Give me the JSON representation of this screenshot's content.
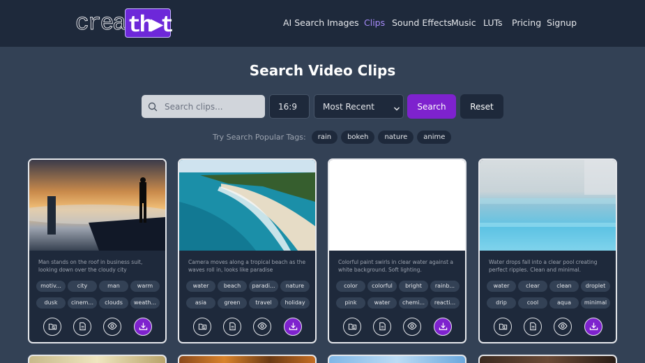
{
  "brand": {
    "logo_a": "create",
    "logo_b": "th▸t"
  },
  "nav": [
    {
      "label": "AI Search",
      "active": false
    },
    {
      "label": "Images",
      "active": false
    },
    {
      "label": "Clips",
      "active": true
    },
    {
      "label": "Sound Effects",
      "active": false
    },
    {
      "label": "Music",
      "active": false
    },
    {
      "label": "LUTs",
      "active": false
    },
    {
      "label": "Pricing",
      "active": false
    },
    {
      "label": "Signup",
      "active": false
    }
  ],
  "page_title": "Search Video Clips",
  "search": {
    "placeholder": "Search clips...",
    "value": ""
  },
  "aspect_select": {
    "value": "16:9"
  },
  "sort_select": {
    "value": "Most Recent"
  },
  "search_button": "Search",
  "reset_button": "Reset",
  "popular": {
    "label": "Try Search Popular Tags:",
    "tags": [
      "rain",
      "bokeh",
      "nature",
      "anime"
    ]
  },
  "cards": [
    {
      "description": "Man stands on the roof in business suit, looking down over the cloudy city",
      "tags": [
        "motiv...",
        "city",
        "man",
        "warm",
        "dusk",
        "cinem...",
        "clouds",
        "weath..."
      ]
    },
    {
      "description": "Camera moves along a tropical beach as the waves roll in, looks like paradise",
      "tags": [
        "water",
        "beach",
        "paradi...",
        "nature",
        "asia",
        "green",
        "travel",
        "holiday"
      ]
    },
    {
      "description": "Colorful paint swirls in clear water against a white background. Soft lighting.",
      "tags": [
        "color",
        "colorful",
        "bright",
        "rainb...",
        "pink",
        "water",
        "chemi...",
        "reacti..."
      ]
    },
    {
      "description": "Water drops fall into a clear pool creating perfect ripples. Clean and minimal.",
      "tags": [
        "water",
        "clear",
        "clean",
        "droplet",
        "drip",
        "cool",
        "aqua",
        "minimal"
      ]
    }
  ],
  "colors": {
    "accent": "#7e22ce",
    "page_bg": "#334155",
    "header_bg": "#1e293b"
  },
  "card_action_icons": [
    "folder-search-icon",
    "document-icon",
    "eye-icon",
    "download-icon"
  ]
}
